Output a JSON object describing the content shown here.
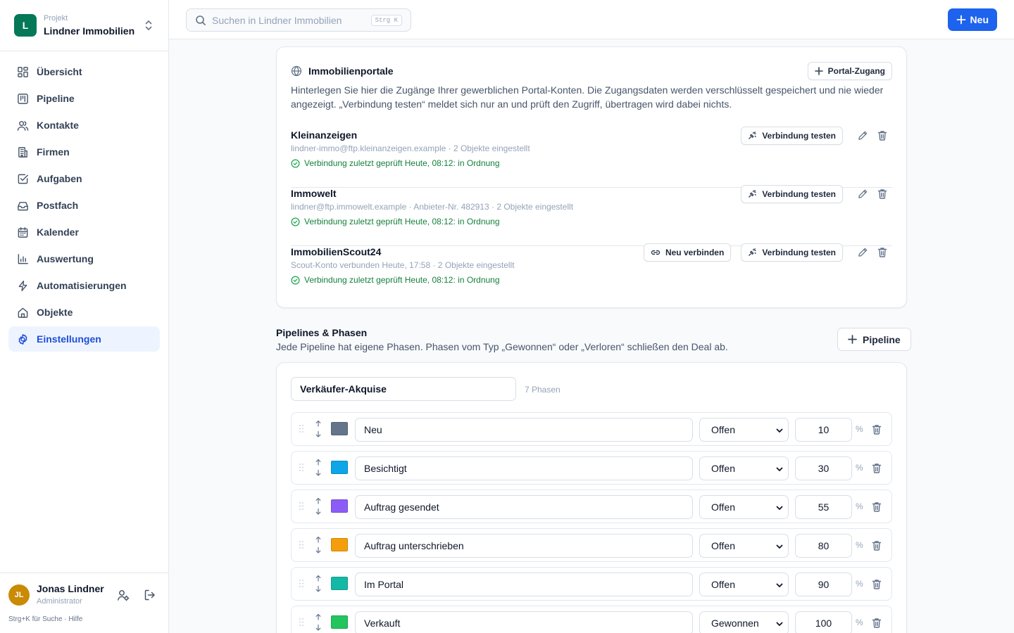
{
  "project": {
    "caption": "Projekt",
    "name": "Lindner Immobilien",
    "initial": "L",
    "color": "#047857"
  },
  "nav": [
    {
      "label": "Übersicht",
      "icon": "grid-icon"
    },
    {
      "label": "Pipeline",
      "icon": "kanban-icon"
    },
    {
      "label": "Kontakte",
      "icon": "users-icon"
    },
    {
      "label": "Firmen",
      "icon": "building-icon"
    },
    {
      "label": "Aufgaben",
      "icon": "check-square-icon"
    },
    {
      "label": "Postfach",
      "icon": "inbox-icon"
    },
    {
      "label": "Kalender",
      "icon": "calendar-icon"
    },
    {
      "label": "Auswertung",
      "icon": "bar-chart-icon"
    },
    {
      "label": "Automatisierungen",
      "icon": "zap-icon"
    },
    {
      "label": "Objekte",
      "icon": "home-icon"
    },
    {
      "label": "Einstellungen",
      "icon": "gear-icon",
      "active": true
    }
  ],
  "user": {
    "initials": "JL",
    "name": "Jonas Lindner",
    "role": "Administrator",
    "avatar_color": "#ca8a04"
  },
  "footer_hint": "Strg+K für Suche · Hilfe",
  "search": {
    "placeholder": "Suchen in Lindner Immobilien",
    "shortcut": "Strg K"
  },
  "new_button": "Neu",
  "accent_color": "#1d63ed",
  "portals": {
    "title": "Immobilienportale",
    "add_button": "Portal-Zugang",
    "description": "Hinterlegen Sie hier die Zugänge Ihrer gewerblichen Portal-Konten. Die Zugangsdaten werden verschlüsselt gespeichert und nie wieder angezeigt. „Verbindung testen“ meldet sich nur an und prüft den Zugriff, übertragen wird dabei nichts.",
    "test_label": "Verbindung testen",
    "reconnect_label": "Neu verbinden",
    "items": [
      {
        "name": "Kleinanzeigen",
        "meta": "lindner-immo@ftp.kleinanzeigen.example · 2 Objekte eingestellt",
        "status": "Verbindung zuletzt geprüft Heute, 08:12: in Ordnung",
        "reconnect": false
      },
      {
        "name": "Immowelt",
        "meta": "lindner@ftp.immowelt.example · Anbieter-Nr. 482913 · 2 Objekte eingestellt",
        "status": "Verbindung zuletzt geprüft Heute, 08:12: in Ordnung",
        "reconnect": false
      },
      {
        "name": "ImmobilienScout24",
        "meta": "Scout-Konto verbunden Heute, 17:58 · 2 Objekte eingestellt",
        "status": "Verbindung zuletzt geprüft Heute, 08:12: in Ordnung",
        "reconnect": true
      }
    ]
  },
  "pipelines": {
    "title": "Pipelines & Phasen",
    "description": "Jede Pipeline hat eigene Phasen. Phasen vom Typ „Gewonnen“ oder „Verloren“ schließen den Deal ab.",
    "add_button": "Pipeline",
    "pipeline_name": "Verkäufer-Akquise",
    "phase_count": "7 Phasen",
    "pct_symbol": "%",
    "phases": [
      {
        "name": "Neu",
        "color": "#64748b",
        "type": "Offen",
        "probability": "10"
      },
      {
        "name": "Besichtigt",
        "color": "#0ea5e9",
        "type": "Offen",
        "probability": "30"
      },
      {
        "name": "Auftrag gesendet",
        "color": "#8b5cf6",
        "type": "Offen",
        "probability": "55"
      },
      {
        "name": "Auftrag unterschrieben",
        "color": "#f59e0b",
        "type": "Offen",
        "probability": "80"
      },
      {
        "name": "Im Portal",
        "color": "#14b8a6",
        "type": "Offen",
        "probability": "90"
      },
      {
        "name": "Verkauft",
        "color": "#22c55e",
        "type": "Gewonnen",
        "probability": "100"
      }
    ]
  }
}
